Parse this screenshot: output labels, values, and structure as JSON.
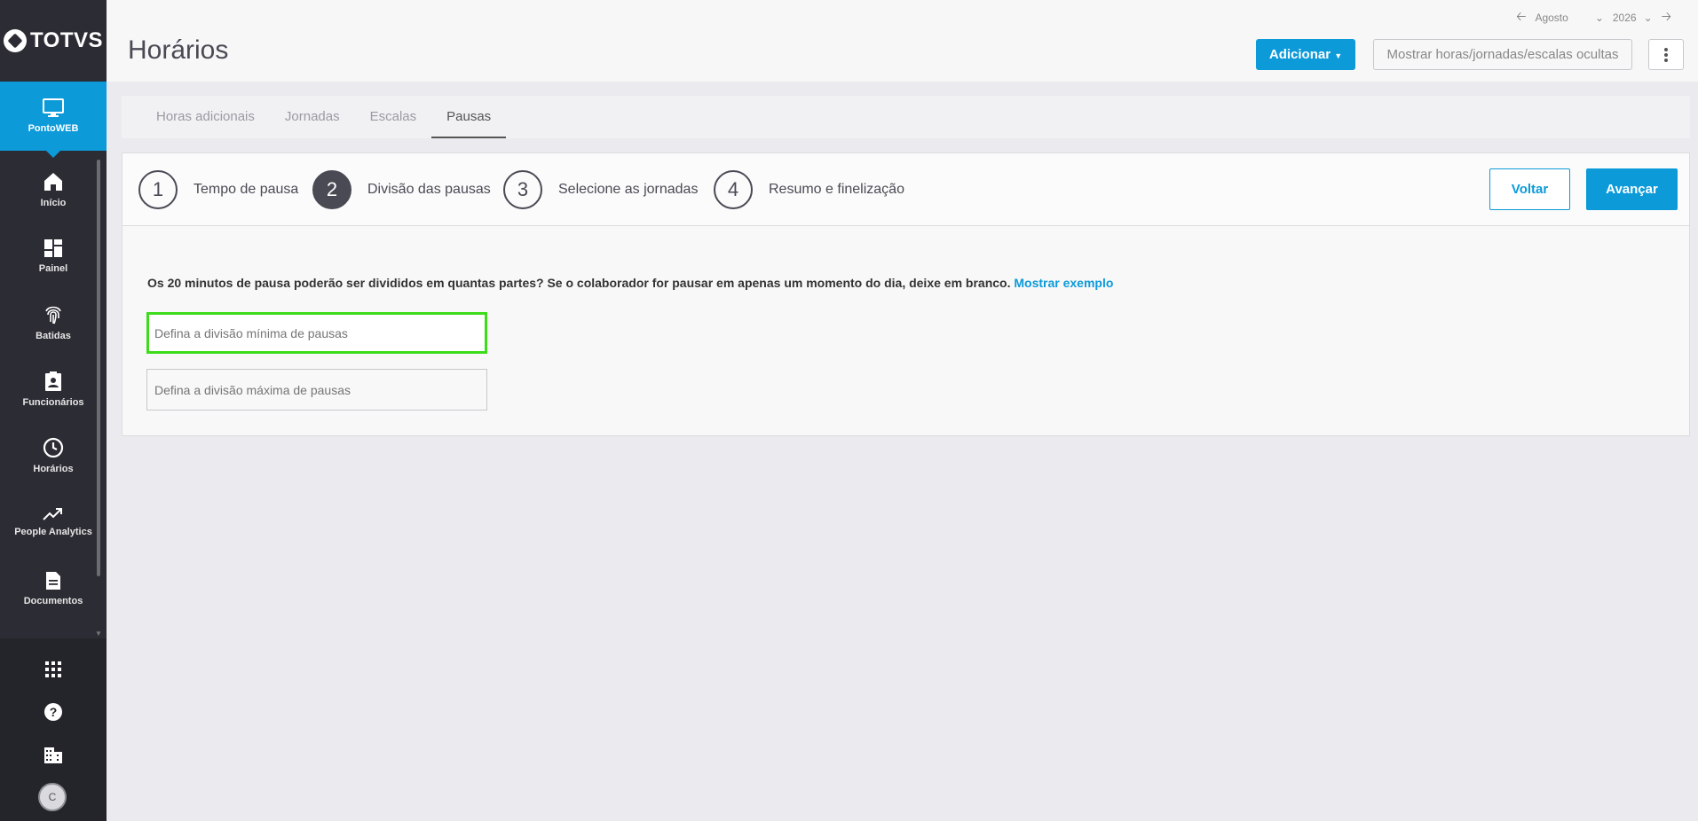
{
  "brand": {
    "logo_text": "TOTVS"
  },
  "sidebar": {
    "app": {
      "label": "PontoWEB",
      "icon": "monitor-icon"
    },
    "items": [
      {
        "label": "Início",
        "icon": "home-icon"
      },
      {
        "label": "Painel",
        "icon": "dashboard-icon"
      },
      {
        "label": "Batidas",
        "icon": "fingerprint-icon"
      },
      {
        "label": "Funcionários",
        "icon": "badge-icon"
      },
      {
        "label": "Horários",
        "icon": "clock-icon"
      },
      {
        "label": "People Analytics",
        "icon": "trending-icon"
      },
      {
        "label": "Documentos",
        "icon": "document-icon"
      }
    ],
    "bottom": [
      "apps-grid-icon",
      "help-icon",
      "building-icon"
    ],
    "avatar_initial": "C"
  },
  "header": {
    "title": "Horários",
    "month": "Agosto",
    "year": "2026",
    "add_label": "Adicionar",
    "hidden_label": "Mostrar horas/jornadas/escalas ocultas"
  },
  "tabs": [
    {
      "label": "Horas adicionais",
      "active": false
    },
    {
      "label": "Jornadas",
      "active": false
    },
    {
      "label": "Escalas",
      "active": false
    },
    {
      "label": "Pausas",
      "active": true
    }
  ],
  "stepper": {
    "steps": [
      {
        "number": "1",
        "label": "Tempo de pausa",
        "active": false
      },
      {
        "number": "2",
        "label": "Divisão das pausas",
        "active": true
      },
      {
        "number": "3",
        "label": "Selecione as jornadas",
        "active": false
      },
      {
        "number": "4",
        "label": "Resumo e finelização",
        "active": false
      }
    ],
    "back_label": "Voltar",
    "next_label": "Avançar"
  },
  "form": {
    "question": "Os 20 minutos de pausa poderão ser divididos em quantas partes? Se o colaborador for pausar em apenas um momento do dia, deixe em branco.",
    "example_link": "Mostrar exemplo",
    "min_placeholder": "Defina a divisão mínima de pausas",
    "max_placeholder": "Defina a divisão máxima de pausas"
  },
  "colors": {
    "primary": "#0c9ad9",
    "sidebar": "#2c2c34",
    "focus": "#3ddc1a"
  }
}
